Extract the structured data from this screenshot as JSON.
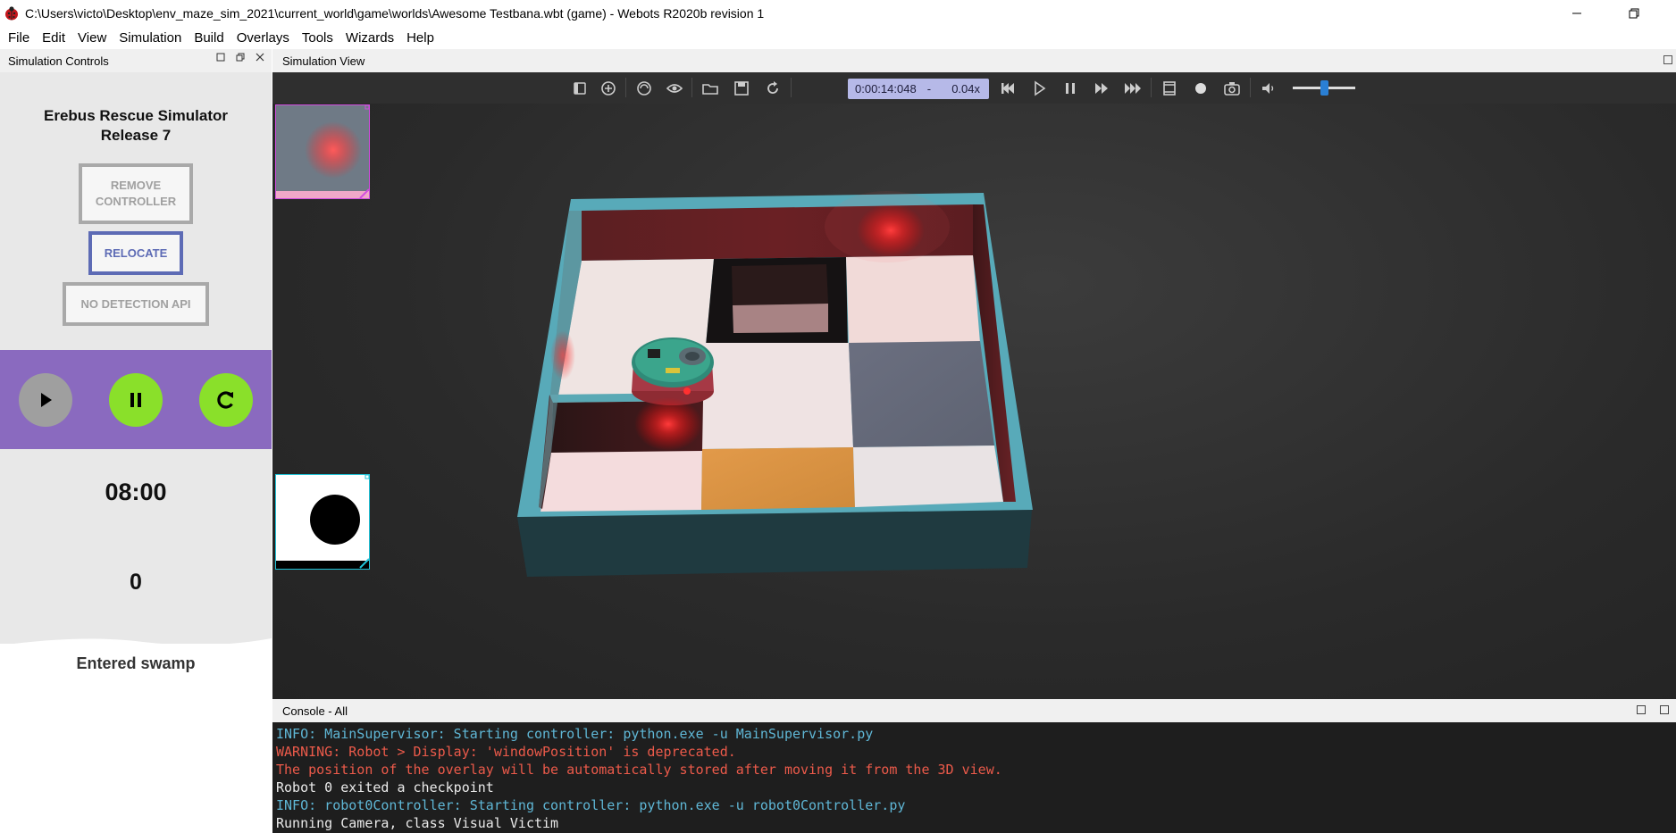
{
  "window": {
    "title": "C:\\Users\\victo\\Desktop\\env_maze_sim_2021\\current_world\\game\\worlds\\Awesome Testbana.wbt (game) - Webots R2020b revision 1",
    "minimize_icon": "minimize-icon",
    "restore_icon": "restore-icon"
  },
  "menu": [
    "File",
    "Edit",
    "View",
    "Simulation",
    "Build",
    "Overlays",
    "Tools",
    "Wizards",
    "Help"
  ],
  "left_dock": {
    "title": "Simulation Controls",
    "panel": {
      "title_line1": "Erebus Rescue Simulator",
      "title_line2": "Release 7",
      "remove_line1": "REMOVE",
      "remove_line2": "CONTROLLER",
      "relocate": "RELOCATE",
      "detection": "NO DETECTION API",
      "timer": "08:00",
      "score": "0",
      "status": "Entered swamp",
      "accent_purple": "#8a6abf",
      "accent_green": "#8ae02a"
    }
  },
  "sim_view": {
    "title": "Simulation View",
    "toolbar": {
      "time": "0:00:14:048",
      "separator": "-",
      "speed": "0.04x",
      "volume_level": 0.5
    }
  },
  "console": {
    "title": "Console - All",
    "lines": [
      {
        "type": "info",
        "text": "INFO: MainSupervisor: Starting controller: python.exe -u MainSupervisor.py"
      },
      {
        "type": "warn",
        "text": "WARNING: Robot > Display: 'windowPosition' is deprecated."
      },
      {
        "type": "warn",
        "text": "The position of the overlay will be automatically stored after moving it from the 3D view."
      },
      {
        "type": "plain",
        "text": "Robot 0 exited a checkpoint"
      },
      {
        "type": "info",
        "text": "INFO: robot0Controller: Starting controller: python.exe -u robot0Controller.py"
      },
      {
        "type": "plain",
        "text": "Running Camera, class Visual Victim"
      }
    ]
  }
}
